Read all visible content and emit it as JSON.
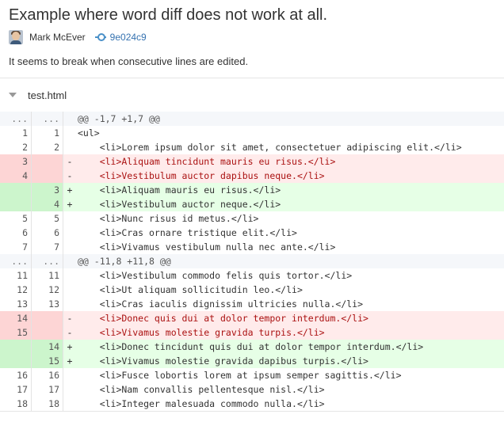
{
  "commit": {
    "title": "Example where word diff does not work at all.",
    "author": "Mark McEver",
    "hash": "9e024c9",
    "description": "It seems to break when consecutive lines are edited."
  },
  "file": {
    "name": "test.html"
  },
  "diff": [
    {
      "type": "hunk",
      "old": "...",
      "new": "...",
      "sign": "",
      "text": "@@ -1,7 +1,7 @@"
    },
    {
      "type": "ctx",
      "old": "1",
      "new": "1",
      "sign": "",
      "text": "<ul>"
    },
    {
      "type": "ctx",
      "old": "2",
      "new": "2",
      "sign": "",
      "text": "    <li>Lorem ipsum dolor sit amet, consectetuer adipiscing elit.</li>"
    },
    {
      "type": "del",
      "old": "3",
      "new": "",
      "sign": "-",
      "text": "    <li>Aliquam tincidunt mauris eu risus.</li>"
    },
    {
      "type": "del",
      "old": "4",
      "new": "",
      "sign": "-",
      "text": "    <li>Vestibulum auctor dapibus neque.</li>"
    },
    {
      "type": "add",
      "old": "",
      "new": "3",
      "sign": "+",
      "text": "    <li>Aliquam mauris eu risus.</li>"
    },
    {
      "type": "add",
      "old": "",
      "new": "4",
      "sign": "+",
      "text": "    <li>Vestibulum auctor neque.</li>"
    },
    {
      "type": "ctx",
      "old": "5",
      "new": "5",
      "sign": "",
      "text": "    <li>Nunc risus id metus.</li>"
    },
    {
      "type": "ctx",
      "old": "6",
      "new": "6",
      "sign": "",
      "text": "    <li>Cras ornare tristique elit.</li>"
    },
    {
      "type": "ctx",
      "old": "7",
      "new": "7",
      "sign": "",
      "text": "    <li>Vivamus vestibulum nulla nec ante.</li>"
    },
    {
      "type": "hunk",
      "old": "...",
      "new": "...",
      "sign": "",
      "text": "@@ -11,8 +11,8 @@"
    },
    {
      "type": "ctx",
      "old": "11",
      "new": "11",
      "sign": "",
      "text": "    <li>Vestibulum commodo felis quis tortor.</li>"
    },
    {
      "type": "ctx",
      "old": "12",
      "new": "12",
      "sign": "",
      "text": "    <li>Ut aliquam sollicitudin leo.</li>"
    },
    {
      "type": "ctx",
      "old": "13",
      "new": "13",
      "sign": "",
      "text": "    <li>Cras iaculis dignissim ultricies nulla.</li>"
    },
    {
      "type": "del",
      "old": "14",
      "new": "",
      "sign": "-",
      "text": "    <li>Donec quis dui at dolor tempor interdum.</li>"
    },
    {
      "type": "del",
      "old": "15",
      "new": "",
      "sign": "-",
      "text": "    <li>Vivamus molestie gravida turpis.</li>"
    },
    {
      "type": "add",
      "old": "",
      "new": "14",
      "sign": "+",
      "text": "    <li>Donec tincidunt quis dui at dolor tempor interdum.</li>"
    },
    {
      "type": "add",
      "old": "",
      "new": "15",
      "sign": "+",
      "text": "    <li>Vivamus molestie gravida dapibus turpis.</li>"
    },
    {
      "type": "ctx",
      "old": "16",
      "new": "16",
      "sign": "",
      "text": "    <li>Fusce lobortis lorem at ipsum semper sagittis.</li>"
    },
    {
      "type": "ctx",
      "old": "17",
      "new": "17",
      "sign": "",
      "text": "    <li>Nam convallis pellentesque nisl.</li>"
    },
    {
      "type": "ctx",
      "old": "18",
      "new": "18",
      "sign": "",
      "text": "    <li>Integer malesuada commodo nulla.</li>"
    }
  ]
}
